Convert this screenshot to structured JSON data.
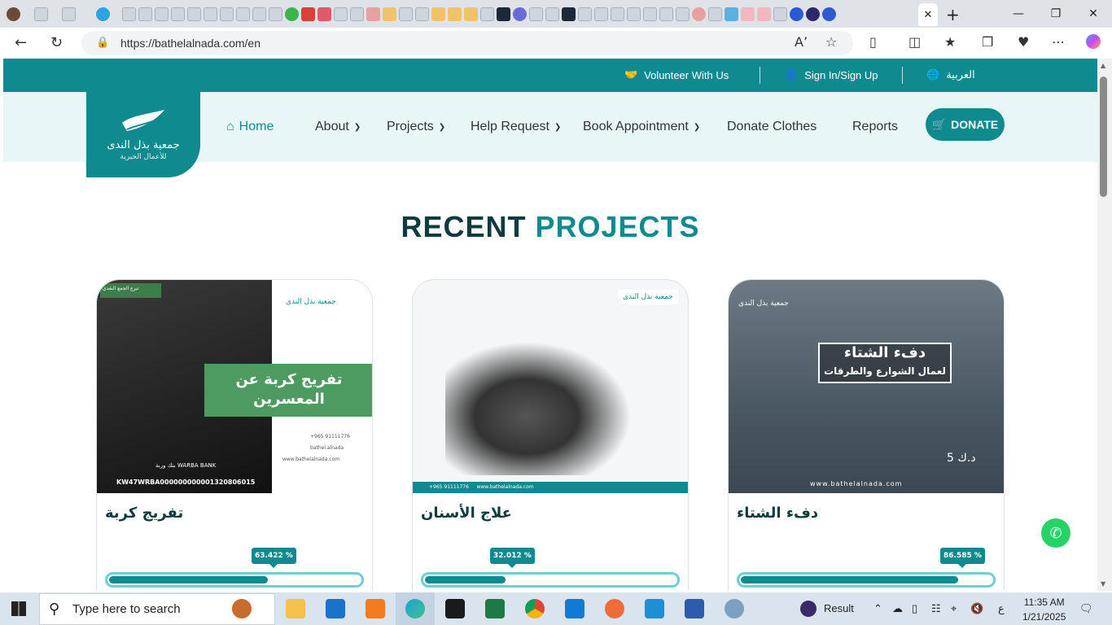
{
  "browser": {
    "url": "https://bathelalnada.com/en",
    "active_tab_close": "✕",
    "new_tab": "+"
  },
  "topbar": {
    "volunteer": "Volunteer With Us",
    "signin": "Sign In/Sign Up",
    "language": "العربية"
  },
  "logo": {
    "name_ar": "جمعية بذل الندى",
    "sub_ar": "للأعمال الخيرية"
  },
  "nav": {
    "home": "Home",
    "about": "About",
    "projects": "Projects",
    "help_request": "Help Request",
    "book_appointment": "Book Appointment",
    "donate_clothes": "Donate Clothes",
    "reports": "Reports",
    "donate": "DONATE"
  },
  "section": {
    "title_part1": "RECENT",
    "title_part2": "PROJECTS"
  },
  "projects": [
    {
      "title": "تفريج كربة",
      "percent_label": "63.422 %",
      "percent": 63.422,
      "image": {
        "banner": "تفريج كربة عن المعسرين",
        "account": "KW47WRBA000000000001320806015",
        "tag": "تبرع الجمع النقدي",
        "bank": "بنك وربة WARBA BANK",
        "phone": "+965 91111776",
        "handle": "bathel.alnada",
        "site": "www.bathelalnada.com"
      }
    },
    {
      "title": "علاج الأسنان",
      "percent_label": "32.012 %",
      "percent": 32.012,
      "image": {
        "phone": "+965 91111776",
        "site": "www.bathelalnada.com"
      }
    },
    {
      "title": "دفء الشتاء",
      "percent_label": "86.585 %",
      "percent": 86.585,
      "image": {
        "box_line1": "دفء الشتاء",
        "box_line2": "لعمال الشوارع والطرقات",
        "price": "5 د.ك",
        "site": "www.bathelalnada.com"
      }
    }
  ],
  "taskbar": {
    "search_placeholder": "Type here to search",
    "result_label": "Result",
    "time": "11:35 AM",
    "date": "1/21/2025",
    "lang": "ع"
  },
  "colors": {
    "brand": "#0f8a8f",
    "dark": "#0d3b3e",
    "nav_bg": "#e8f6f7"
  }
}
